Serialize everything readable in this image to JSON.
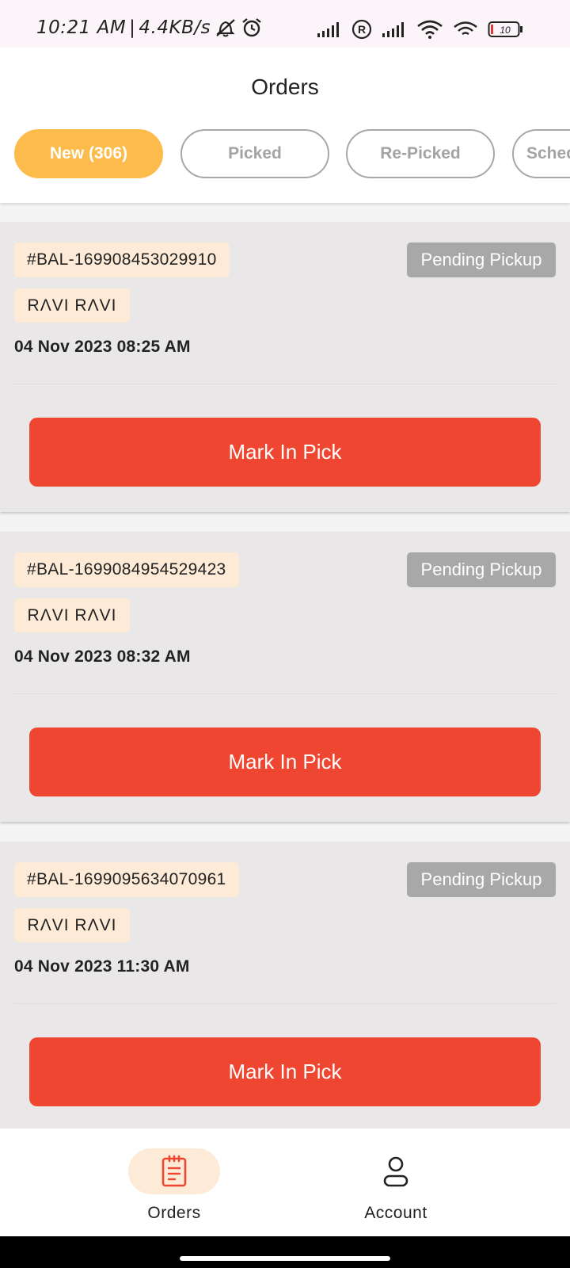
{
  "status_bar": {
    "time": "10:21 AM",
    "network_speed": "4.4KB/s",
    "battery_level": "10",
    "icons": [
      "mute-icon",
      "alarm-icon",
      "signal-icon",
      "roaming-icon",
      "signal-icon",
      "wifi-icon",
      "wifi-icon",
      "battery-icon"
    ]
  },
  "header": {
    "title": "Orders"
  },
  "tabs": [
    {
      "label": "New (306)",
      "active": true
    },
    {
      "label": "Picked",
      "active": false
    },
    {
      "label": "Re-Picked",
      "active": false
    },
    {
      "label": "Scheduled",
      "active": false
    }
  ],
  "orders": [
    {
      "id": "#BAL-169908453029910",
      "status": "Pending Pickup",
      "customer": "RΛVI  RΛVI",
      "date": "04 Nov 2023 08:25 AM",
      "action": "Mark In Pick"
    },
    {
      "id": "#BAL-1699084954529423",
      "status": "Pending Pickup",
      "customer": "RΛVI  RΛVI",
      "date": "04 Nov 2023 08:32 AM",
      "action": "Mark In Pick"
    },
    {
      "id": "#BAL-1699095634070961",
      "status": "Pending Pickup",
      "customer": "RΛVI  RΛVI",
      "date": "04 Nov 2023 11:30 AM",
      "action": "Mark In Pick"
    }
  ],
  "bottom_nav": [
    {
      "label": "Orders",
      "icon": "orders-icon",
      "active": true
    },
    {
      "label": "Account",
      "icon": "account-icon",
      "active": false
    }
  ],
  "colors": {
    "accent_tab": "#fcbb4a",
    "action_button": "#ee4630",
    "badge_gray": "#a8a8a8",
    "chip_bg": "#fdebd7",
    "card_bg": "#e9e7e8"
  }
}
